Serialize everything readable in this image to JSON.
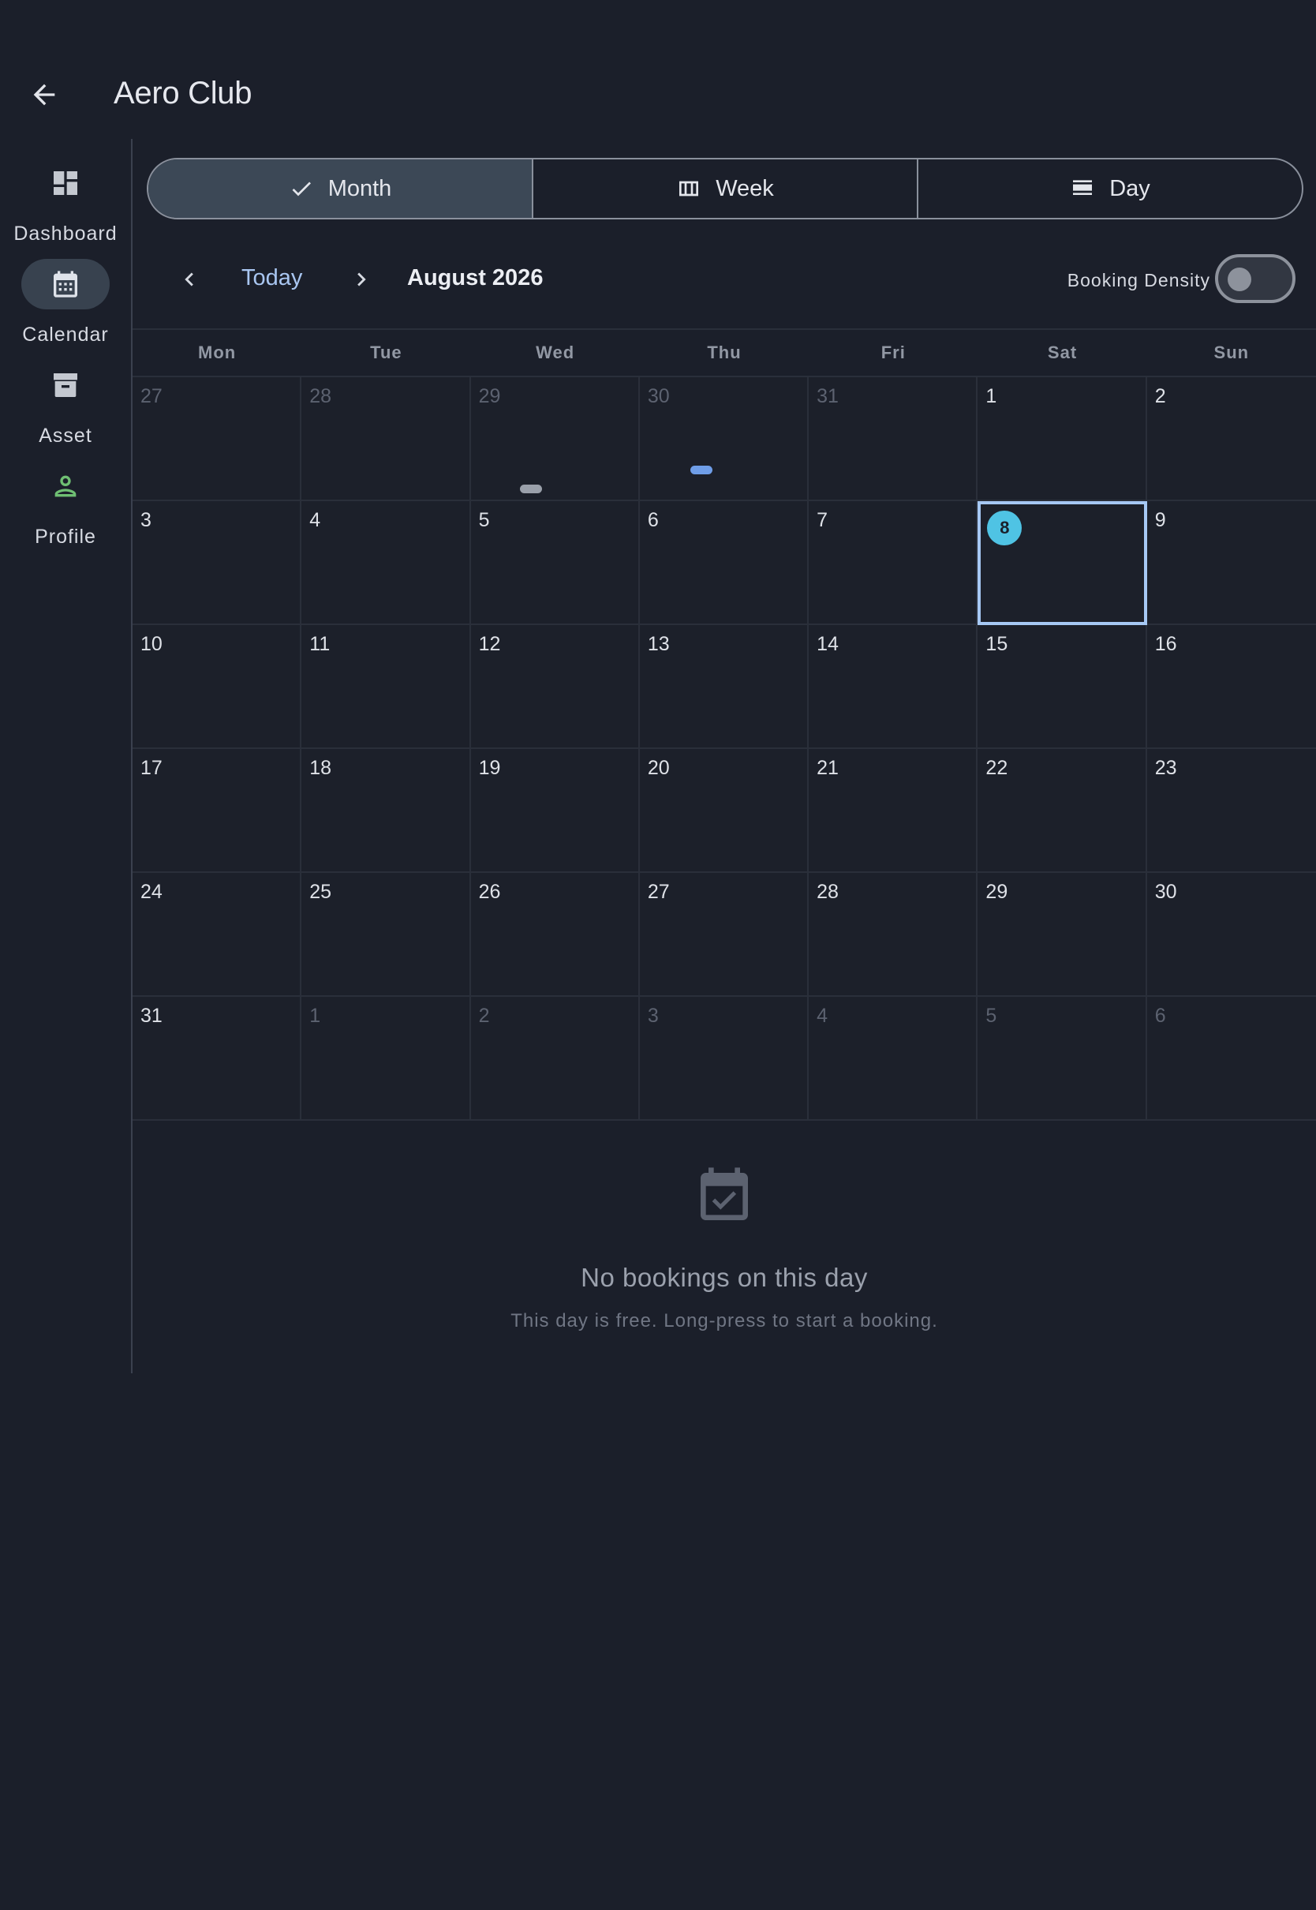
{
  "app": {
    "title": "Aero Club"
  },
  "rail": {
    "items": [
      {
        "label": "Dashboard",
        "icon": "dashboard-icon",
        "active": false
      },
      {
        "label": "Calendar",
        "icon": "calendar-icon",
        "active": true
      },
      {
        "label": "Asset",
        "icon": "archive-icon",
        "active": false
      },
      {
        "label": "Profile",
        "icon": "person-icon",
        "active": false,
        "icon_color": "#6fbf73"
      }
    ]
  },
  "view_toggle": {
    "options": [
      {
        "label": "Month",
        "icon": "check-icon",
        "selected": true
      },
      {
        "label": "Week",
        "icon": "view-week-icon",
        "selected": false
      },
      {
        "label": "Day",
        "icon": "view-day-icon",
        "selected": false
      }
    ]
  },
  "nav": {
    "today_label": "Today",
    "month_label": "August 2026",
    "density_label": "Booking Density",
    "density_on": false
  },
  "calendar": {
    "weekdays": [
      "Mon",
      "Tue",
      "Wed",
      "Thu",
      "Fri",
      "Sat",
      "Sun"
    ],
    "weeks": [
      [
        {
          "d": "27",
          "out": true
        },
        {
          "d": "28",
          "out": true
        },
        {
          "d": "29",
          "out": true,
          "booking": "#9aa0aa"
        },
        {
          "d": "30",
          "out": true,
          "booking": "#6f9ee8"
        },
        {
          "d": "31",
          "out": true
        },
        {
          "d": "1"
        },
        {
          "d": "2"
        }
      ],
      [
        {
          "d": "3"
        },
        {
          "d": "4"
        },
        {
          "d": "5"
        },
        {
          "d": "6"
        },
        {
          "d": "7"
        },
        {
          "d": "8",
          "selected": true
        },
        {
          "d": "9"
        }
      ],
      [
        {
          "d": "10"
        },
        {
          "d": "11"
        },
        {
          "d": "12"
        },
        {
          "d": "13"
        },
        {
          "d": "14"
        },
        {
          "d": "15"
        },
        {
          "d": "16"
        }
      ],
      [
        {
          "d": "17"
        },
        {
          "d": "18"
        },
        {
          "d": "19"
        },
        {
          "d": "20"
        },
        {
          "d": "21"
        },
        {
          "d": "22"
        },
        {
          "d": "23"
        }
      ],
      [
        {
          "d": "24"
        },
        {
          "d": "25"
        },
        {
          "d": "26"
        },
        {
          "d": "27"
        },
        {
          "d": "28"
        },
        {
          "d": "29"
        },
        {
          "d": "30"
        }
      ],
      [
        {
          "d": "31"
        },
        {
          "d": "1",
          "out": true
        },
        {
          "d": "2",
          "out": true
        },
        {
          "d": "3",
          "out": true
        },
        {
          "d": "4",
          "out": true
        },
        {
          "d": "5",
          "out": true
        },
        {
          "d": "6",
          "out": true
        }
      ]
    ]
  },
  "empty_state": {
    "icon": "event-available-icon",
    "title": "No bookings on this day",
    "subtitle": "This day is free. Long-press to start a booking."
  },
  "colors": {
    "background": "#1b1f2a",
    "accent": "#a9c6f1",
    "today_badge": "#4fc3e4",
    "selection_border": "#a6c8f4"
  }
}
